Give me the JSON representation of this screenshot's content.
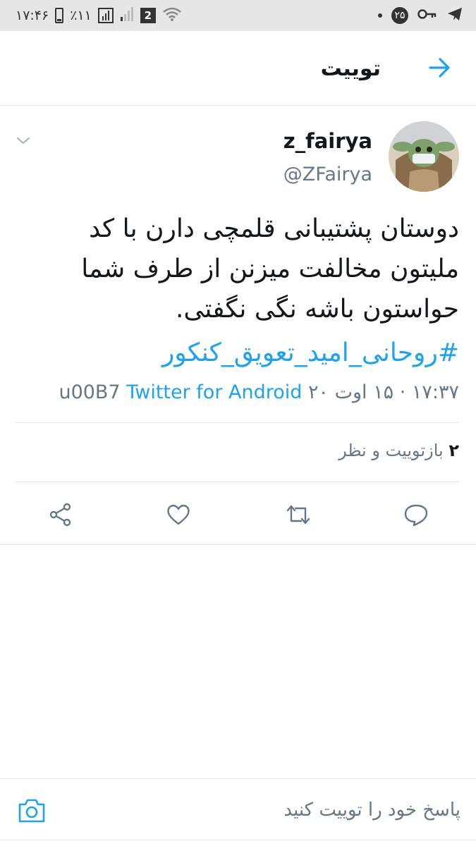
{
  "status_bar": {
    "time": "۱۷:۴۶",
    "battery": "٪۱۱",
    "sim_slot": "2",
    "badge_count": "۲۵",
    "icons": [
      "battery-icon",
      "signal-icon",
      "signal-weak-icon",
      "sim-icon",
      "wifi-icon",
      "dot-icon",
      "notification-badge",
      "key-icon",
      "telegram-icon"
    ]
  },
  "header": {
    "title": "توییت"
  },
  "tweet": {
    "display_name": "z_fairya",
    "handle": "@ZFairya",
    "text": "دوستان پشتیبانی قلمچی دارن با کد ملیتون مخالفت میزنن از طرف شما حواستون باشه نگی نگفتی.",
    "hashtag": "#روحانی_امید_تعویق_کنکور",
    "timestamp": "۱۷:۳۷ · ۱۵ اوت ۲۰",
    "separator": "u00B7",
    "source": "Twitter for Android"
  },
  "stats": {
    "count": "۲",
    "label": "بازتوییت و نظر"
  },
  "actions": {
    "icons": [
      "share-icon",
      "like-icon",
      "retweet-icon",
      "reply-icon"
    ]
  },
  "reply_bar": {
    "placeholder": "پاسخ خود را توییت کنید"
  },
  "colors": {
    "accent": "#1da1f2",
    "text": "#14171a",
    "secondary": "#657786",
    "divider": "#e1e8ed",
    "status_bar": "#e6e6e6"
  }
}
